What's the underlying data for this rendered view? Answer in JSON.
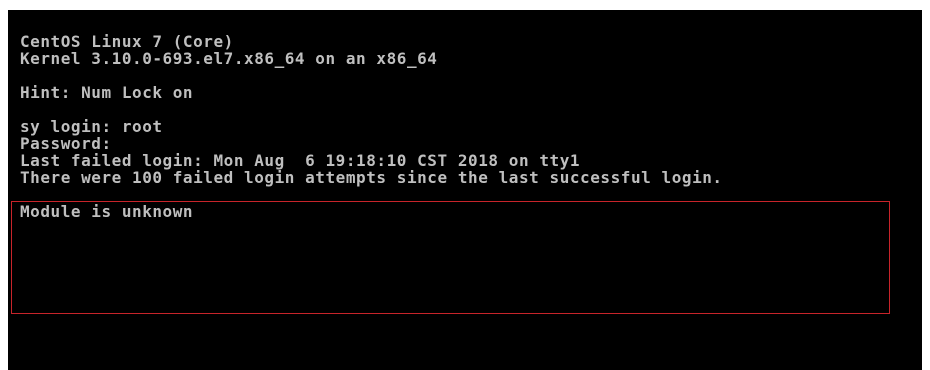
{
  "terminal": {
    "lines": {
      "os_name": "CentOS Linux 7 (Core)",
      "kernel": "Kernel 3.10.0-693.el7.x86_64 on an x86_64",
      "hint": "Hint: Num Lock on",
      "login_prompt": "sy login: root",
      "password_prompt": "Password:",
      "last_failed": "Last failed login: Mon Aug  6 19:18:10 CST 2018 on tty1",
      "failed_attempts": "There were 100 failed login attempts since the last successful login.",
      "module_error": "Module is unknown"
    }
  },
  "colors": {
    "background": "#000000",
    "text": "#bfbfbf",
    "highlight_border": "#c8242a"
  }
}
